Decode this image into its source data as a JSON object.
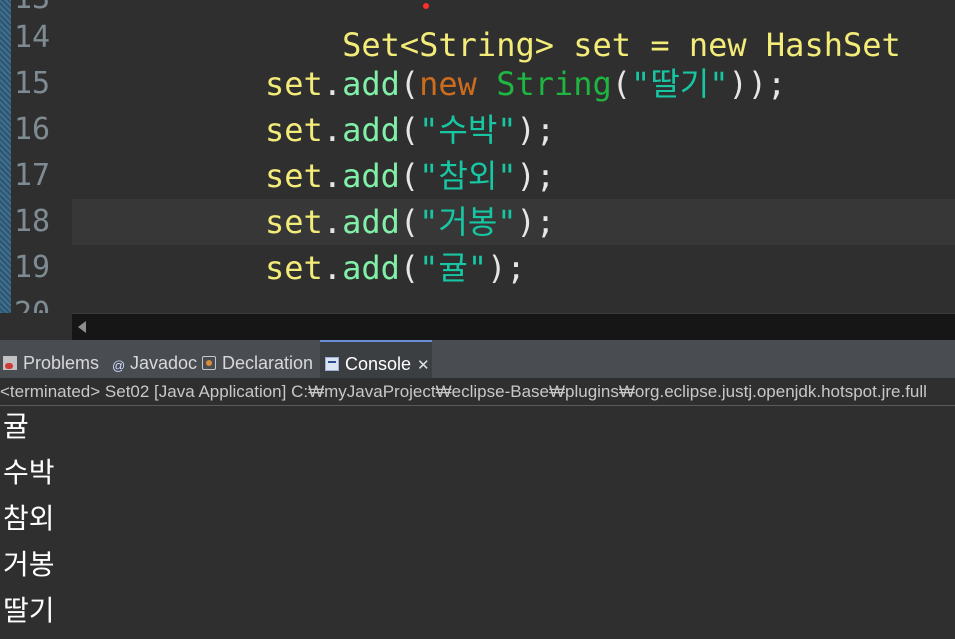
{
  "editor": {
    "line_numbers": [
      "14",
      "15",
      "16",
      "17",
      "18",
      "19"
    ],
    "top_partial_line": {
      "number": "13",
      "code": "Set<String> set = new HashSet"
    },
    "bottom_partial_line_number": "20",
    "lines": [
      {
        "var": "set",
        "method": "add",
        "open": "(",
        "kw": "new ",
        "type": "String",
        "args_open": "(",
        "str": "\"딸기\"",
        "close": "));"
      },
      {
        "var": "set",
        "method": "add",
        "open": "(",
        "str": "\"수박\"",
        "close": ");"
      },
      {
        "var": "set",
        "method": "add",
        "open": "(",
        "str": "\"참외\"",
        "close": ");"
      },
      {
        "var": "set",
        "method": "add",
        "open": "(",
        "str": "\"거봉\"",
        "close": ");"
      },
      {
        "var": "set",
        "method": "add",
        "open": "(",
        "str": "\"귤\"",
        "close": ");"
      }
    ],
    "dot": "."
  },
  "tabs": {
    "problems": "Problems",
    "javadoc": "Javadoc",
    "declaration": "Declaration",
    "console": "Console",
    "console_close": "✕"
  },
  "console": {
    "header": "<terminated> Set02 [Java Application] C:₩myJavaProject₩eclipse-Base₩plugins₩org.eclipse.justj.openjdk.hotspot.jre.full",
    "output": [
      "귤",
      "수박",
      "참외",
      "거봉",
      "딸기"
    ]
  },
  "colors": {
    "editor_bg": "#2f2f2f",
    "keyword": "#cc6c1d",
    "string": "#17c6a3",
    "variable": "#f3ec79",
    "method": "#80f0a8",
    "console_tab_accent": "#6b8fd6"
  }
}
